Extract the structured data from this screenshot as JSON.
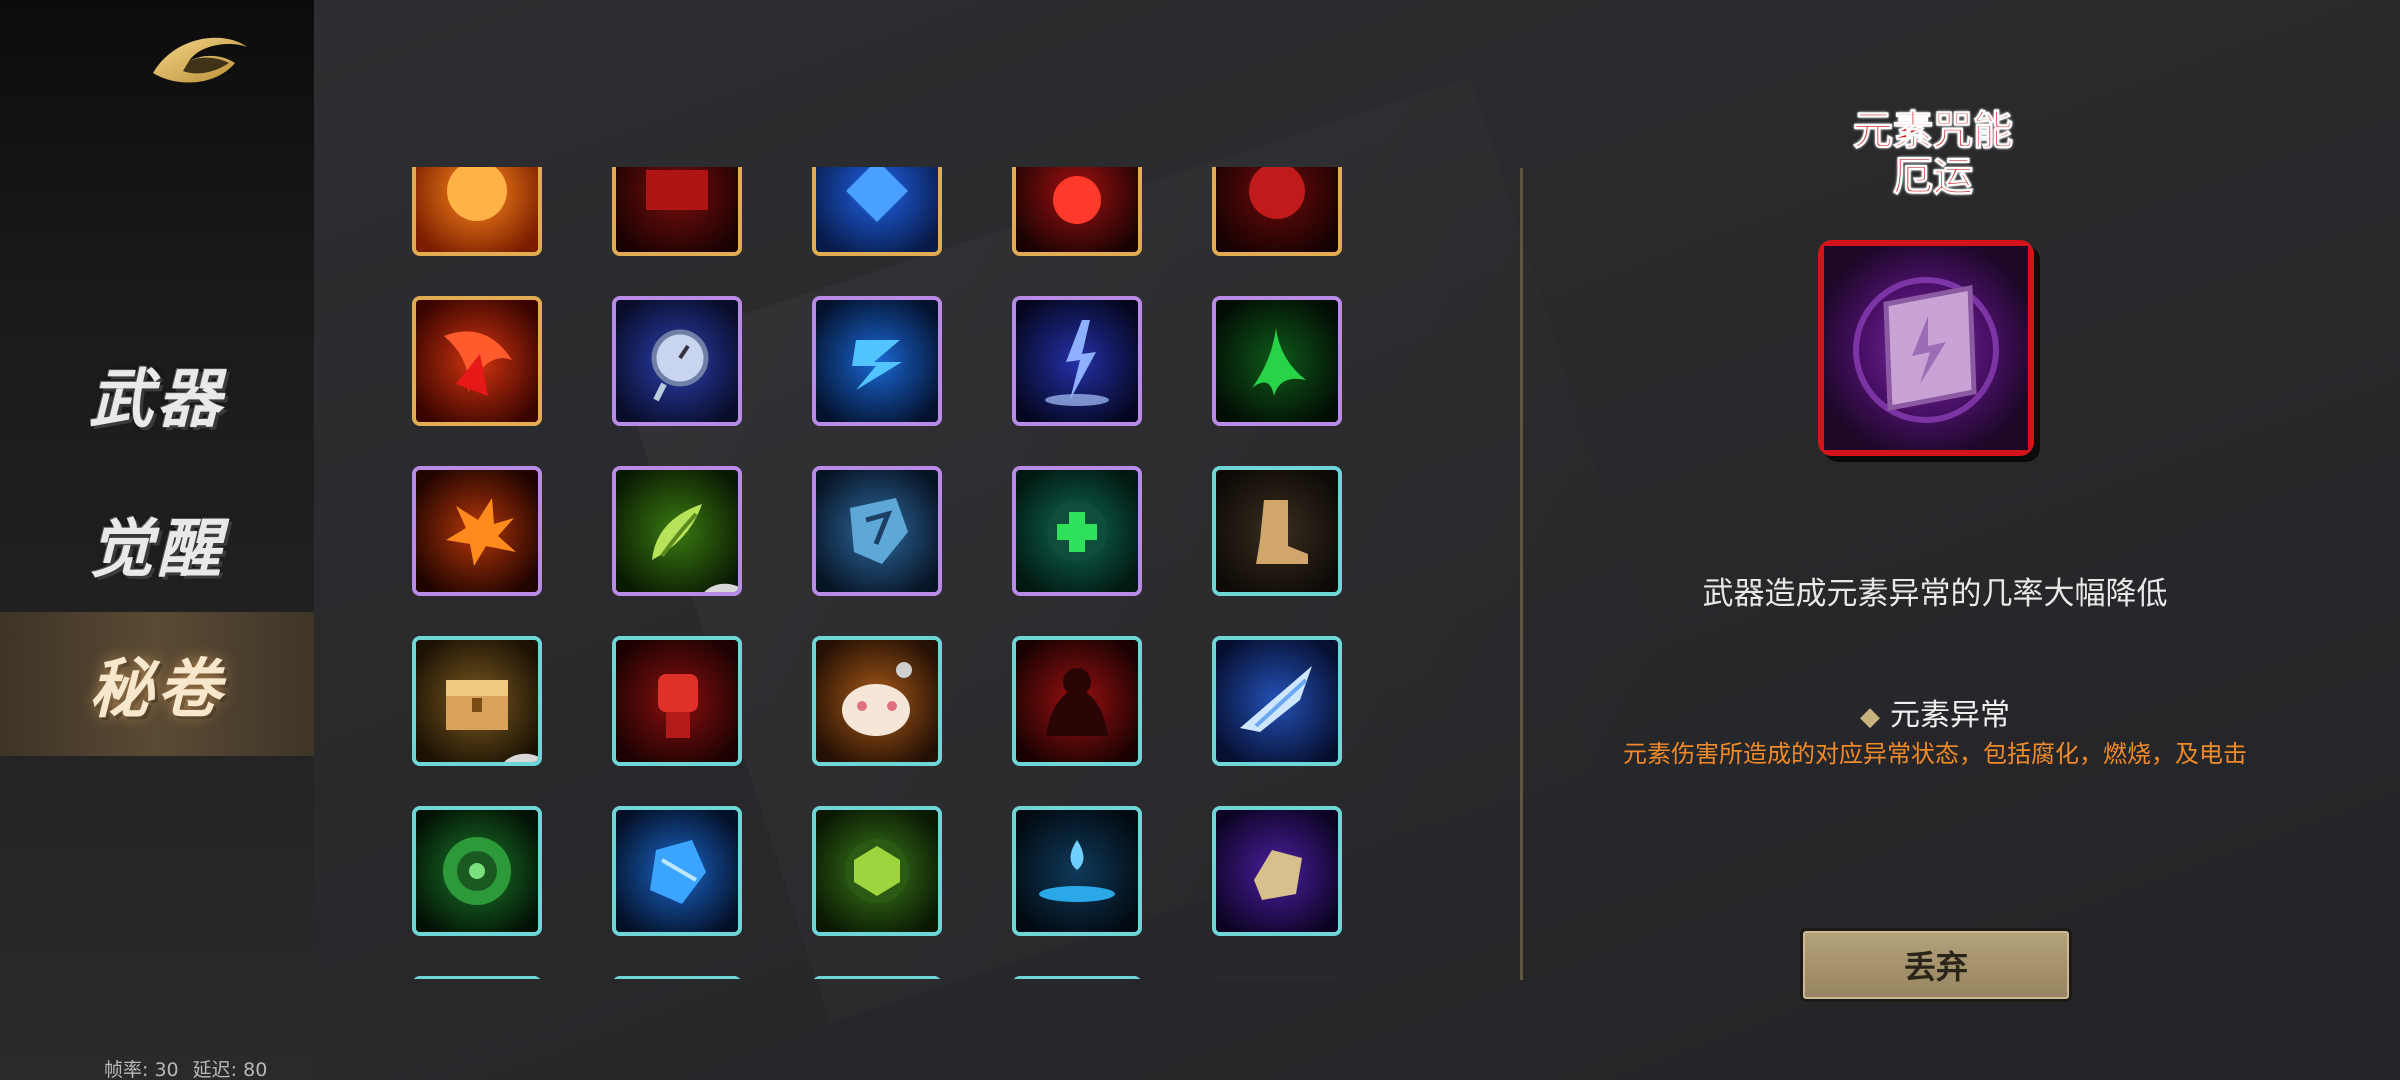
{
  "sidebar": {
    "logo_icon": "crescent-swoosh-logo",
    "items": [
      {
        "label": "武器"
      },
      {
        "label": "觉醒"
      },
      {
        "label": "秘卷",
        "selected": true
      }
    ]
  },
  "stats": {
    "fps": "帧率: 30",
    "latency": "延迟: 80"
  },
  "grid": {
    "rows": [
      [
        {
          "icon": "fire-rune-icon",
          "rarity": "gold"
        },
        {
          "icon": "blood-sigil-icon",
          "rarity": "gold"
        },
        {
          "icon": "blue-crystal-icon",
          "rarity": "gold"
        },
        {
          "icon": "crimson-flare-icon",
          "rarity": "gold"
        },
        {
          "icon": "red-orb-icon",
          "rarity": "gold"
        }
      ],
      [
        {
          "icon": "fire-claw-icon",
          "rarity": "gold"
        },
        {
          "icon": "pocket-watch-icon",
          "rarity": "purple"
        },
        {
          "icon": "lightning-bolt-icon",
          "rarity": "purple"
        },
        {
          "icon": "thunder-strike-icon",
          "rarity": "purple"
        },
        {
          "icon": "green-thorn-icon",
          "rarity": "purple"
        }
      ],
      [
        {
          "icon": "fire-burst-icon",
          "rarity": "purple"
        },
        {
          "icon": "herb-leaf-icon",
          "rarity": "purple",
          "locked": true
        },
        {
          "icon": "ice-shield-icon",
          "rarity": "purple"
        },
        {
          "icon": "heal-cross-icon",
          "rarity": "purple"
        },
        {
          "icon": "boot-icon",
          "rarity": "cyan"
        }
      ],
      [
        {
          "icon": "treasure-chest-icon",
          "rarity": "cyan",
          "locked": true
        },
        {
          "icon": "fist-icon",
          "rarity": "cyan"
        },
        {
          "icon": "sleeping-pet-icon",
          "rarity": "cyan"
        },
        {
          "icon": "demon-silhouette-icon",
          "rarity": "cyan"
        },
        {
          "icon": "ice-blade-icon",
          "rarity": "cyan"
        }
      ],
      [
        {
          "icon": "green-vortex-icon",
          "rarity": "cyan"
        },
        {
          "icon": "ice-crystal-icon",
          "rarity": "cyan"
        },
        {
          "icon": "green-gem-icon",
          "rarity": "cyan"
        },
        {
          "icon": "water-drop-icon",
          "rarity": "cyan"
        },
        {
          "icon": "purple-stone-icon",
          "rarity": "cyan"
        }
      ],
      [
        {
          "icon": "ember-icon",
          "rarity": "cyan"
        },
        {
          "icon": "golden-swirl-icon",
          "rarity": "cyan"
        },
        {
          "icon": "gold-nugget-icon",
          "rarity": "cyan"
        },
        {
          "icon": "blue-spike-icon",
          "rarity": "cyan"
        },
        {
          "icon": "empty-slot",
          "rarity": "empty"
        }
      ]
    ]
  },
  "detail": {
    "title_line1": "元素咒能",
    "title_line2": "厄运",
    "icon": "cursed-card-icon",
    "description": "武器造成元素异常的几率大幅降低",
    "keyword": "元素异常",
    "keyword_desc": "元素伤害所造成的对应异常状态，包括腐化，燃烧，及电击",
    "discard_label": "丢弃"
  },
  "colors": {
    "title_red": "#d0191d",
    "keyword_orange": "#f08a2a",
    "gold_border": "#e2ad52",
    "purple_border": "#b98be6",
    "cyan_border": "#6fd6d8"
  }
}
